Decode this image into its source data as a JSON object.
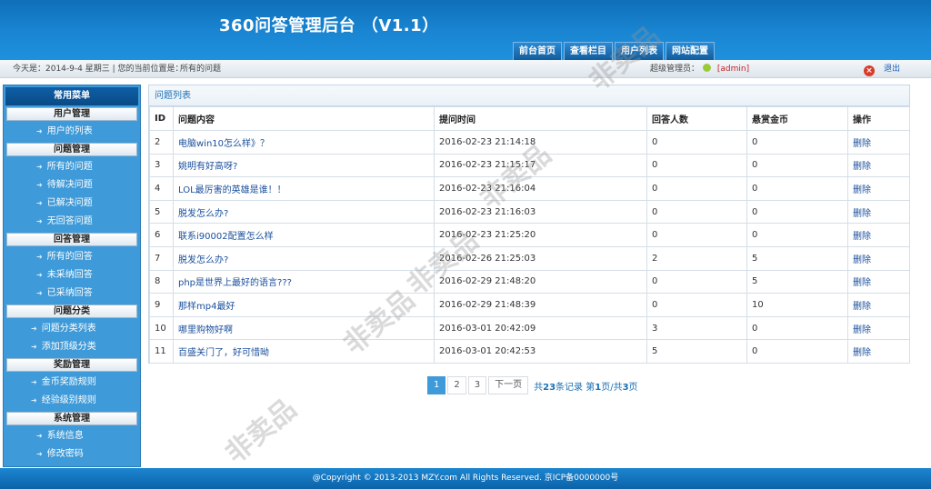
{
  "header": {
    "title": "360问答管理后台 （V1.1）",
    "nav": [
      "前台首页",
      "查看栏目",
      "用户列表",
      "网站配置"
    ]
  },
  "status": {
    "date_text": "今天是：2014-9-4 星期三 | 您的当前位置是：",
    "location": "所有的问题",
    "admin_label": "超级管理员：",
    "admin_name": "[admin]",
    "logout": "退出"
  },
  "sidebar": {
    "heading": "常用菜单",
    "groups": [
      {
        "title": "用户管理",
        "items": [
          "用户的列表"
        ]
      },
      {
        "title": "问题管理",
        "items": [
          "所有的问题",
          "待解决问题",
          "已解决问题",
          "无回答问题"
        ]
      },
      {
        "title": "回答管理",
        "items": [
          "所有的回答",
          "未采纳回答",
          "已采纳回答"
        ]
      },
      {
        "title": "问题分类",
        "items": [
          "问题分类列表",
          "添加顶级分类"
        ]
      },
      {
        "title": "奖励管理",
        "items": [
          "金币奖励规则",
          "经验级别规则"
        ]
      },
      {
        "title": "系统管理",
        "items": [
          "系统信息",
          "修改密码"
        ]
      }
    ]
  },
  "panel": {
    "title": "问题列表",
    "columns": [
      "ID",
      "问题内容",
      "提问时间",
      "回答人数",
      "悬赏金币",
      "操作"
    ],
    "rows": [
      [
        "2",
        "电脑win10怎么样》？",
        "2016-02-23 21:14:18",
        "0",
        "0",
        "删除"
      ],
      [
        "3",
        "姚明有好高呀?",
        "2016-02-23 21:15:17",
        "0",
        "0",
        "删除"
      ],
      [
        "4",
        "LOL最厉害的英雄是谁！！",
        "2016-02-23 21:16:04",
        "0",
        "0",
        "删除"
      ],
      [
        "5",
        "脱发怎么办?",
        "2016-02-23 21:16:03",
        "0",
        "0",
        "删除"
      ],
      [
        "6",
        "联系i90002配置怎么样",
        "2016-02-23 21:25:20",
        "0",
        "0",
        "删除"
      ],
      [
        "7",
        "脱发怎么办?",
        "2016-02-26 21:25:03",
        "2",
        "5",
        "删除"
      ],
      [
        "8",
        "php是世界上最好的语言???",
        "2016-02-29 21:48:20",
        "0",
        "5",
        "删除"
      ],
      [
        "9",
        "那样mp4最好",
        "2016-02-29 21:48:39",
        "0",
        "10",
        "删除"
      ],
      [
        "10",
        "哪里购物好啊",
        "2016-03-01 20:42:09",
        "3",
        "0",
        "删除"
      ],
      [
        "11",
        "百盛关门了，好可惜呦",
        "2016-03-01 20:42:53",
        "5",
        "0",
        "删除"
      ]
    ]
  },
  "pager": {
    "pages": [
      "1",
      "2",
      "3"
    ],
    "next": "下一页",
    "info_prefix": "共",
    "total": "23",
    "info_mid": "条记录 第",
    "current": "1",
    "info_mid2": "页/共",
    "page_count": "3",
    "info_suffix": "页"
  },
  "footer": {
    "text": "@Copyright © 2013-2013 MZY.com All Rights Reserved. 京ICP备0000000号"
  },
  "watermark": "非卖品"
}
